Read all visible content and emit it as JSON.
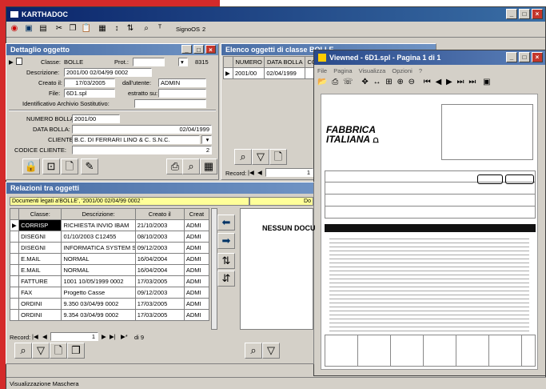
{
  "app": {
    "title": "KARTHADOC"
  },
  "toolbar": {
    "user_label": "SignoOS",
    "extra_label": "2"
  },
  "detail": {
    "title": "Dettaglio oggetto",
    "classe_label": "Classe:",
    "classe_value": "BOLLE",
    "prot_label": "Prot.:",
    "prot_number": "8315",
    "descrizione_label": "Descrizione:",
    "descrizione_value": "2001/00 02/04/99 0002",
    "creato_label": "Creato il:",
    "creato_value": "17/03/2005",
    "utente_label": "dall'utente:",
    "utente_value": "ADMIN",
    "file_label": "File:",
    "file_value": "6D1.spl",
    "estratto_label": "estratto su:",
    "archivio_label": "Identificativo Archivio Sostitutivo:",
    "numero_label": "NUMERO BOLLA:",
    "numero_value": "2001/00",
    "data_label": "DATA BOLLA:",
    "data_value": "02/04/1999",
    "cliente_label": "CLIENTE:",
    "cliente_value": "B.C. DI FERRARI LINO & C. S.N.C.",
    "codice_label": "CODICE CLIENTE:",
    "codice_value": "2"
  },
  "elenco": {
    "title": "Elenco oggetti di classe BOLLE",
    "col1": "NUMERO",
    "col2": "DATA BOLLA",
    "col3": "CO",
    "row_num": "2001/00",
    "row_date": "02/04/1999",
    "record_label": "Record:",
    "record_value": "1"
  },
  "viewer": {
    "title": "Viewned - 6D1.spl - Pagina 1 di 1",
    "menu": [
      "File",
      "Pagina",
      "Visualizza",
      "Opzioni",
      "?"
    ],
    "logo_line1": "FABBRICA",
    "logo_line2": "ITALIANA"
  },
  "relazioni": {
    "title": "Relazioni tra oggetti",
    "banner": "Documenti legati a'BOLLE', '2001/00 02/04/99 0002 '",
    "banner_right": "Do",
    "columns": [
      "Classe:",
      "Descrizione:",
      "Creato il",
      "Creat"
    ],
    "rows": [
      {
        "classe": "CORRISP",
        "desc": "RICHIESTA INVIO IBAM",
        "date": "21/10/2003",
        "user": "ADMI"
      },
      {
        "classe": "DISEGNI",
        "desc": "01/10/2003 C12455",
        "date": "08/10/2003",
        "user": "ADMI"
      },
      {
        "classe": "DISEGNI",
        "desc": "INFORMATICA SYSTEM S.P",
        "date": "09/12/2003",
        "user": "ADMI"
      },
      {
        "classe": "E.MAIL",
        "desc": "NORMAL",
        "date": "16/04/2004",
        "user": "ADMI"
      },
      {
        "classe": "E.MAIL",
        "desc": "NORMAL",
        "date": "16/04/2004",
        "user": "ADMI"
      },
      {
        "classe": "FATTURE",
        "desc": "1001 10/05/1999 0002",
        "date": "17/03/2005",
        "user": "ADMI"
      },
      {
        "classe": "FAX",
        "desc": "Progetto Casse",
        "date": "09/12/2003",
        "user": "ADMI"
      },
      {
        "classe": "ORDINI",
        "desc": "9.350 03/04/99 0002",
        "date": "17/03/2005",
        "user": "ADMI"
      },
      {
        "classe": "ORDINI",
        "desc": "9.354 03/04/99 0002",
        "date": "17/03/2005",
        "user": "ADMI"
      }
    ],
    "record_label": "Record:",
    "record_value": "1",
    "record_total": "di 9",
    "nessun": "NESSUN DOCU"
  },
  "status": {
    "text": "Visualizzazione Maschera"
  },
  "colors": {
    "titlebar": "#0a246a",
    "panel": "#d4d0c8",
    "accent_red": "#d42a2a",
    "banner_yellow": "#ffff99"
  }
}
